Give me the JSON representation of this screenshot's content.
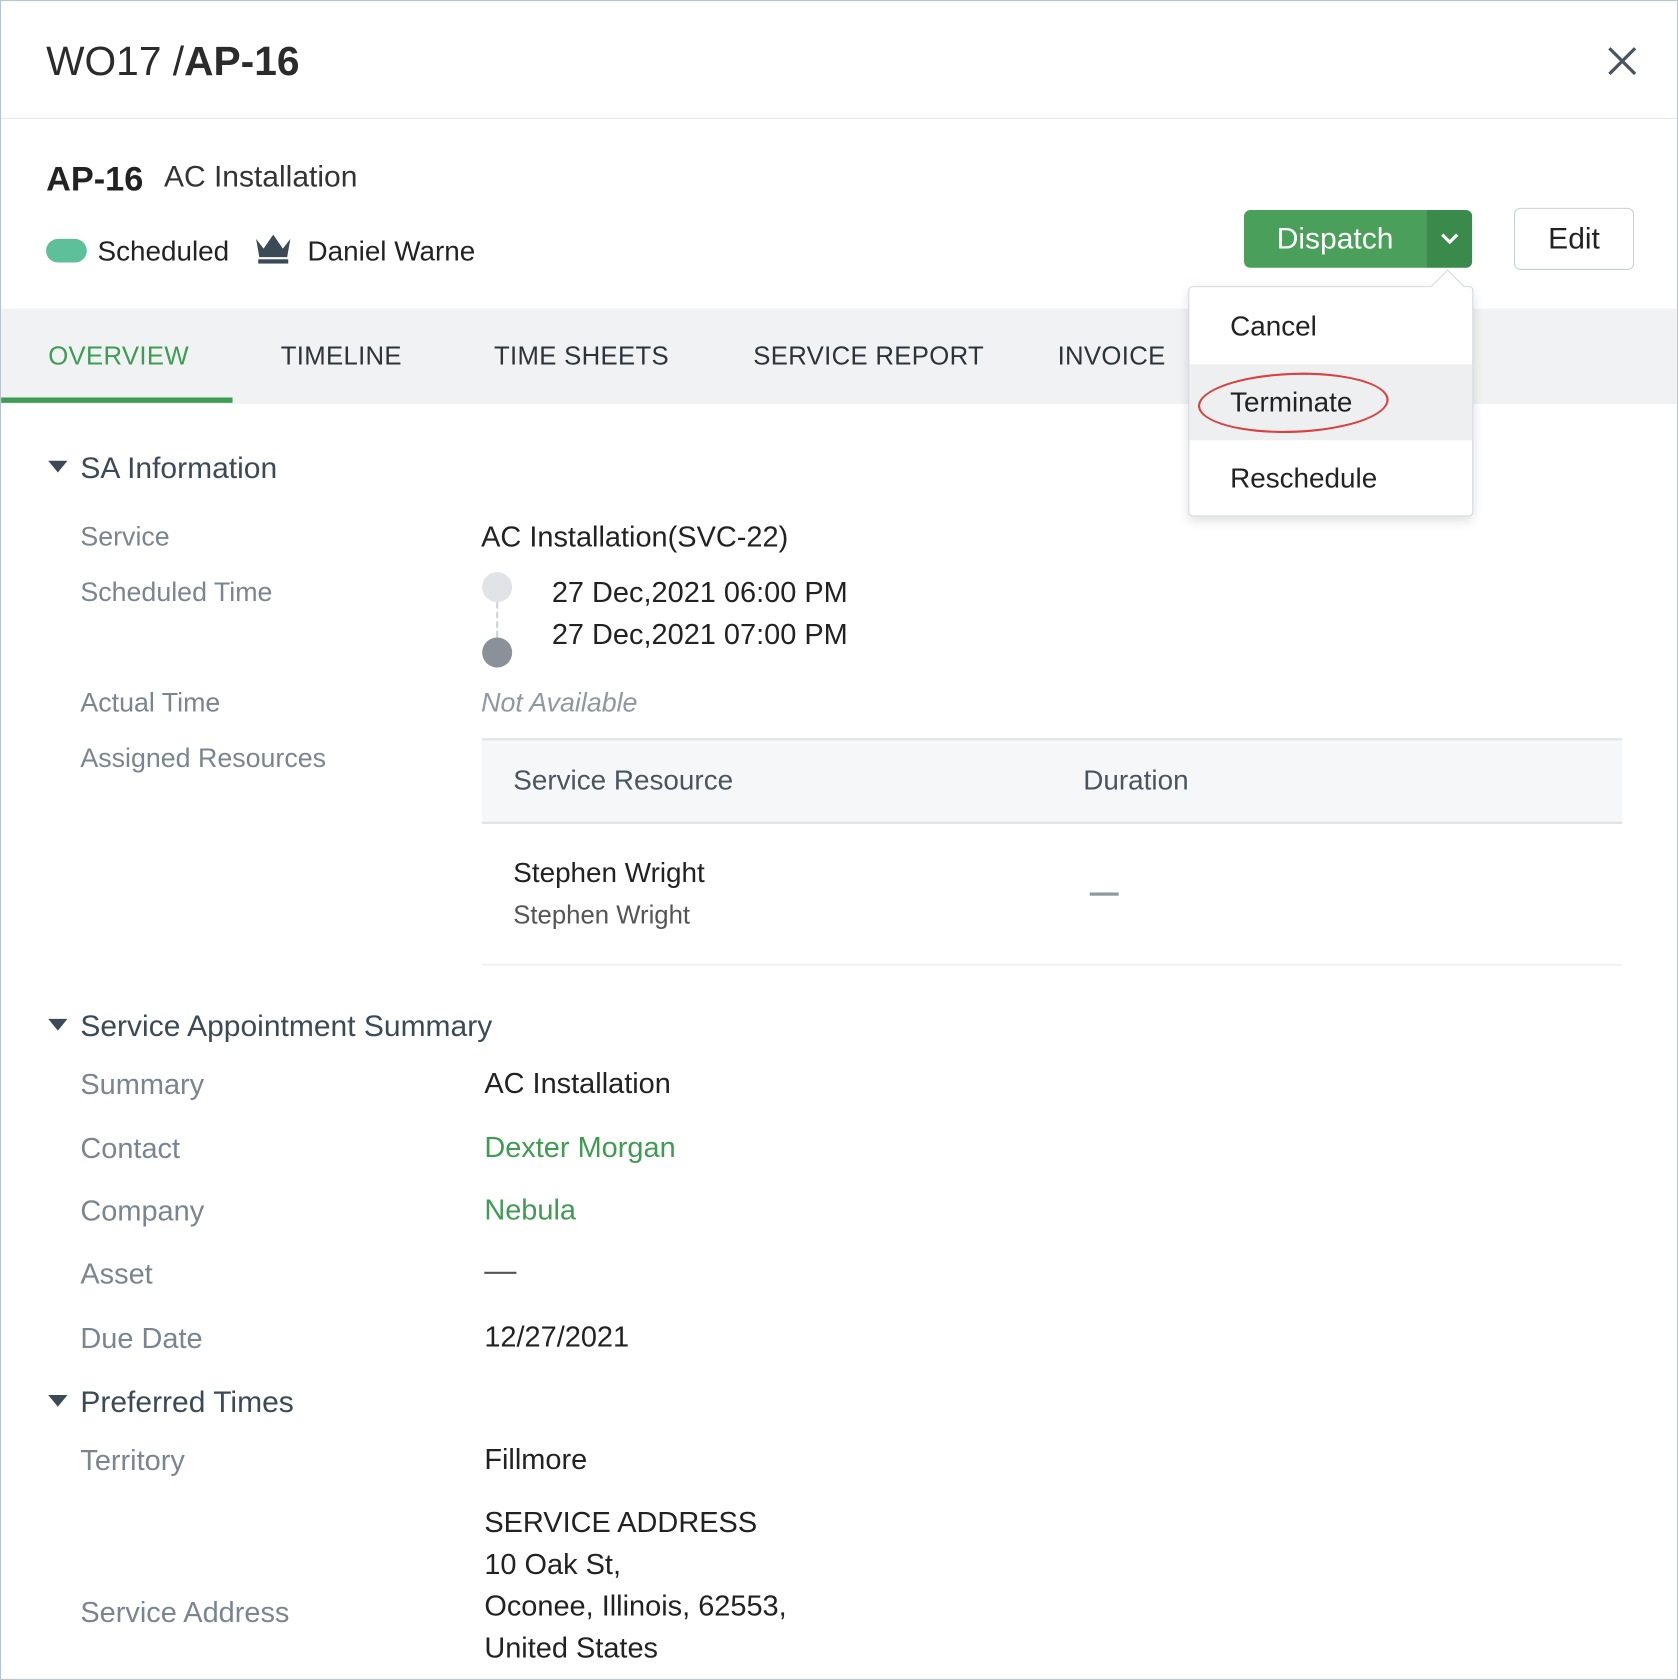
{
  "header": {
    "wo": "WO17 /",
    "ap": "AP-16"
  },
  "record": {
    "id": "AP-16",
    "name": "AC Installation",
    "status": "Scheduled",
    "status_color": "#5ec09a",
    "owner": "Daniel Warne"
  },
  "actions": {
    "dispatch": "Dispatch",
    "edit": "Edit",
    "dropdown": [
      "Cancel",
      "Terminate",
      "Reschedule"
    ]
  },
  "tabs": [
    "OVERVIEW",
    "TIMELINE",
    "TIME SHEETS",
    "SERVICE REPORT",
    "INVOICE"
  ],
  "sa_info": {
    "title": "SA Information",
    "service_label": "Service",
    "service_value": "AC Installation(SVC-22)",
    "scheduled_label": "Scheduled Time",
    "scheduled_start": "27 Dec,2021 06:00 PM",
    "scheduled_end": "27 Dec,2021 07:00 PM",
    "actual_label": "Actual Time",
    "actual_value": "Not Available",
    "resources_label": "Assigned Resources",
    "table_headers": [
      "Service Resource",
      "Duration"
    ],
    "resource_name": "Stephen Wright",
    "resource_sub": "Stephen Wright"
  },
  "summary": {
    "title": "Service Appointment Summary",
    "summary_label": "Summary",
    "summary_value": "AC Installation",
    "contact_label": "Contact",
    "contact_value": "Dexter Morgan",
    "company_label": "Company",
    "company_value": "Nebula",
    "asset_label": "Asset",
    "due_label": "Due Date",
    "due_value": "12/27/2021"
  },
  "preferred": {
    "title": "Preferred Times",
    "territory_label": "Territory",
    "territory_value": "Fillmore",
    "address_label": "Service Address",
    "address_lines": [
      "SERVICE ADDRESS",
      "10 Oak St,",
      "Oconee, Illinois, 62553,",
      "United States"
    ]
  },
  "colors": {
    "accent": "#3f9c53",
    "dispatch": "#4aa05a",
    "highlight_ring": "#d9413f"
  }
}
